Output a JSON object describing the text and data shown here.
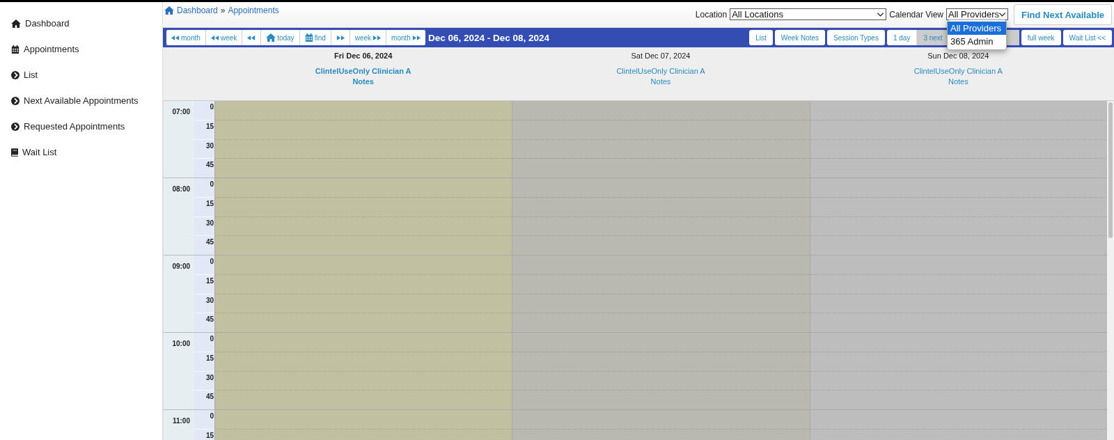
{
  "sidebar": {
    "items": [
      {
        "kind": "home",
        "label": "Dashboard"
      },
      {
        "kind": "calendar",
        "label": "Appointments"
      },
      {
        "kind": "chevron",
        "label": "List"
      },
      {
        "kind": "chevron",
        "label": "Next Available Appointments"
      },
      {
        "kind": "chevron",
        "label": "Requested Appointments"
      },
      {
        "kind": "book",
        "label": "Wait List"
      }
    ]
  },
  "breadcrumb": [
    {
      "label": "Dashboard"
    },
    {
      "label": "Appointments"
    }
  ],
  "breadcrumb_separator": "»",
  "location": {
    "label": "Location",
    "value": "All Locations"
  },
  "calendar_view": {
    "label": "Calendar View",
    "value": "All Providers",
    "expanded": true,
    "options": [
      {
        "label": "All Providers",
        "selected": true
      },
      {
        "label": "365 Admin",
        "selected": false
      }
    ]
  },
  "find_next_button": "Find Next Available",
  "toolbar": {
    "nav_buttons": [
      {
        "kind": "back",
        "label": "month"
      },
      {
        "kind": "back",
        "label": "week"
      },
      {
        "kind": "back"
      },
      {
        "kind": "today",
        "label": "today"
      },
      {
        "kind": "find",
        "label": "find"
      },
      {
        "kind": "forward"
      },
      {
        "kind": "forward",
        "label": "week"
      },
      {
        "kind": "forward",
        "label": "month"
      }
    ],
    "range": "Dec 06, 2024 - Dec 08, 2024",
    "view_buttons": [
      {
        "label": "List",
        "selected": false
      },
      {
        "label": "Week Notes",
        "selected": false
      },
      {
        "label": "Session Types",
        "selected": false
      },
      {
        "label": "1 day",
        "selected": false
      },
      {
        "label": "3 next",
        "selected": true
      },
      {
        "label": "full week",
        "selected": false
      },
      {
        "label": "Wait List <<",
        "selected": false
      }
    ]
  },
  "days": [
    {
      "date": "Fri Dec 06, 2024",
      "provider": "ClintelUseOnly Clinician A",
      "notes": "Notes",
      "today": true,
      "color": "#c1c1a1"
    },
    {
      "date": "Sat Dec 07, 2024",
      "provider": "ClintelUseOnly Clinician A",
      "notes": "Notes",
      "today": false,
      "color": "#b9b9b2"
    },
    {
      "date": "Sun Dec 08, 2024",
      "provider": "ClintelUseOnly Clinician A",
      "notes": "Notes",
      "today": false,
      "color": "#bdbdbd"
    }
  ],
  "hours": [
    {
      "time": "07:00",
      "minutes": [
        "0",
        "15",
        "30",
        "45"
      ]
    },
    {
      "time": "08:00",
      "minutes": [
        "0",
        "15",
        "30",
        "45"
      ]
    },
    {
      "time": "09:00",
      "minutes": [
        "0",
        "15",
        "30",
        "45"
      ]
    },
    {
      "time": "10:00",
      "minutes": [
        "0",
        "15",
        "30",
        "45"
      ]
    },
    {
      "time": "11:00",
      "minutes": [
        "0",
        "15"
      ]
    }
  ]
}
